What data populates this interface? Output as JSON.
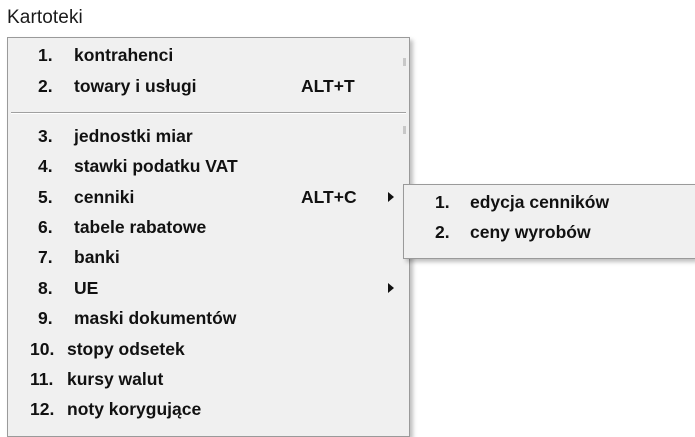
{
  "menubar": {
    "title": "Kartoteki"
  },
  "menu": {
    "items": [
      {
        "num": "1.",
        "label": "kontrahenci",
        "shortcut": ""
      },
      {
        "num": "2.",
        "label": "towary i usługi",
        "shortcut": "ALT+T"
      },
      {
        "num": "3.",
        "label": "jednostki miar",
        "shortcut": ""
      },
      {
        "num": "4.",
        "label": "stawki podatku VAT",
        "shortcut": ""
      },
      {
        "num": "5.",
        "label": "cenniki",
        "shortcut": "ALT+C",
        "submenu": true
      },
      {
        "num": "6.",
        "label": "tabele rabatowe",
        "shortcut": ""
      },
      {
        "num": "7.",
        "label": "banki",
        "shortcut": ""
      },
      {
        "num": "8.",
        "label": "UE",
        "shortcut": "",
        "submenu": true
      },
      {
        "num": "9.",
        "label": "maski dokumentów",
        "shortcut": ""
      },
      {
        "num": "10.",
        "label": "stopy odsetek",
        "shortcut": ""
      },
      {
        "num": "11.",
        "label": "kursy walut",
        "shortcut": ""
      },
      {
        "num": "12.",
        "label": "noty korygujące",
        "shortcut": ""
      }
    ]
  },
  "submenu": {
    "items": [
      {
        "num": "1.",
        "label": "edycja cenników"
      },
      {
        "num": "2.",
        "label": "ceny wyrobów"
      }
    ]
  },
  "colors": {
    "menu_background": "#f0f0f0",
    "menu_border": "#9a9a9a",
    "text": "#111111"
  },
  "icons": {
    "submenu_arrow": "chevron-right-icon"
  }
}
